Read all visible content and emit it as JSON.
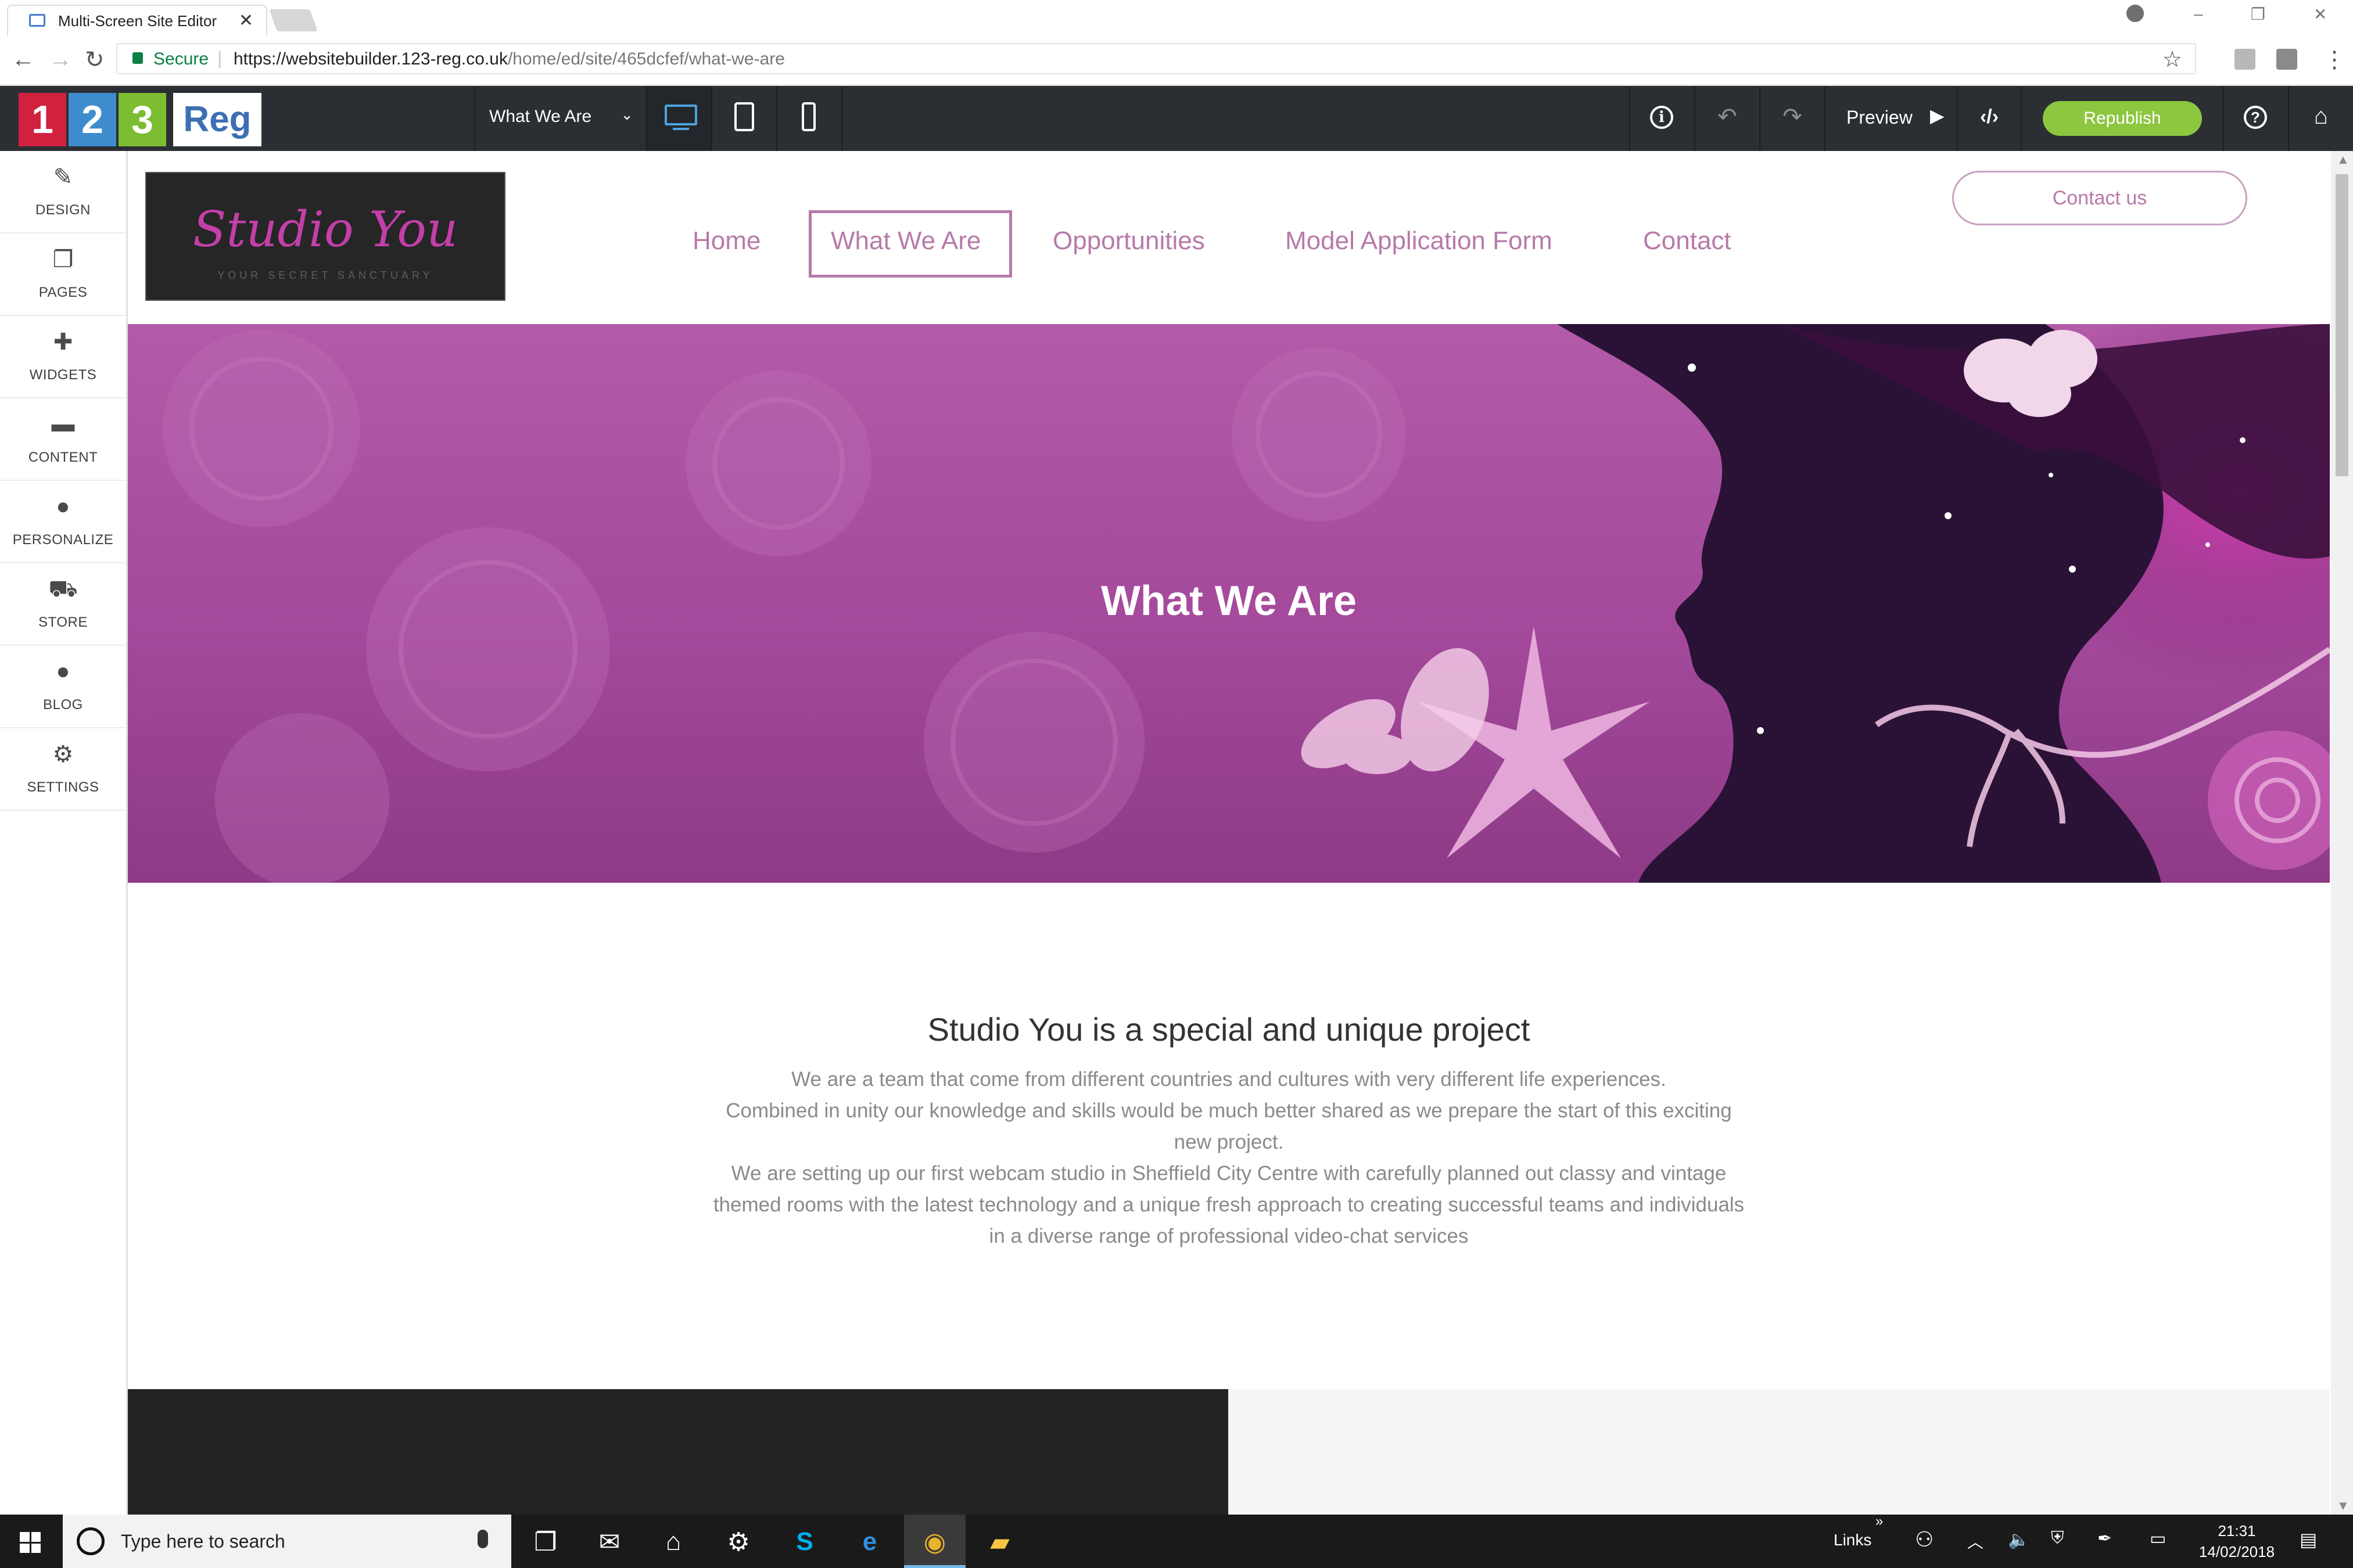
{
  "browser": {
    "tab_title": "Multi-Screen Site Editor",
    "tab_close": "✕",
    "secure_label": "Secure",
    "url_host": "https://websitebuilder.123-reg.co.uk",
    "url_path": "/home/ed/site/465dcfef/what-we-are",
    "window_controls": [
      "–",
      "❐",
      "✕"
    ]
  },
  "editor": {
    "logo": {
      "d1": "1",
      "d2": "2",
      "d3": "3",
      "reg": "Reg"
    },
    "current_page": "What We Are",
    "devices": [
      "desktop-icon",
      "tablet-icon",
      "phone-icon"
    ],
    "active_device": "desktop",
    "preview_label": "Preview",
    "republish_label": "Republish",
    "info_glyph": "i",
    "help_glyph": "?",
    "accent_color": "#8dc63f",
    "toolbar_color": "#2b2e33"
  },
  "sidebar": {
    "items": [
      {
        "label": "DESIGN",
        "icon": "brush-icon",
        "glyph": "✎"
      },
      {
        "label": "PAGES",
        "icon": "pages-icon",
        "glyph": "❐"
      },
      {
        "label": "WIDGETS",
        "icon": "plus-icon",
        "glyph": "✚"
      },
      {
        "label": "CONTENT",
        "icon": "folder-icon",
        "glyph": "▬"
      },
      {
        "label": "PERSONALIZE",
        "icon": "user-icon",
        "glyph": "●"
      },
      {
        "label": "STORE",
        "icon": "cart-icon",
        "glyph": "⛟"
      },
      {
        "label": "BLOG",
        "icon": "chat-bubble-icon",
        "glyph": "●"
      },
      {
        "label": "SETTINGS",
        "icon": "gear-icon",
        "glyph": "⚙"
      }
    ]
  },
  "site": {
    "logo_text": "Studio You",
    "logo_tagline": "YOUR SECRET SANCTUARY",
    "nav": [
      "Home",
      "What We Are",
      "Opportunities",
      "Model Application Form",
      "Contact"
    ],
    "active_nav": "What We Are",
    "contact_button": "Contact us",
    "hero_title": "What We Are",
    "intro_heading": "Studio You is a special and unique project",
    "intro_lines": [
      "We are a team that come from different countries and cultures with very different life experiences.",
      "Combined in unity our knowledge and skills would be much better shared as we prepare the start of this exciting",
      "new project.",
      "We are setting up our first webcam studio in Sheffield City Centre with carefully planned out classy and vintage",
      "themed rooms with the latest technology and a unique fresh approach to creating successful teams and individuals",
      "in a diverse range of professional video-chat services"
    ],
    "brand_color": "#b77aa8",
    "hero_color": "#a8479a"
  },
  "taskbar": {
    "search_placeholder": "Type here to search",
    "apps": [
      "task-view-icon",
      "mail-icon",
      "store-icon",
      "settings-icon",
      "skype-icon",
      "edge-icon",
      "chrome-icon",
      "file-explorer-icon"
    ],
    "links_label": "Links",
    "links_chevron": "»",
    "time": "21:31",
    "date": "14/02/2018"
  }
}
